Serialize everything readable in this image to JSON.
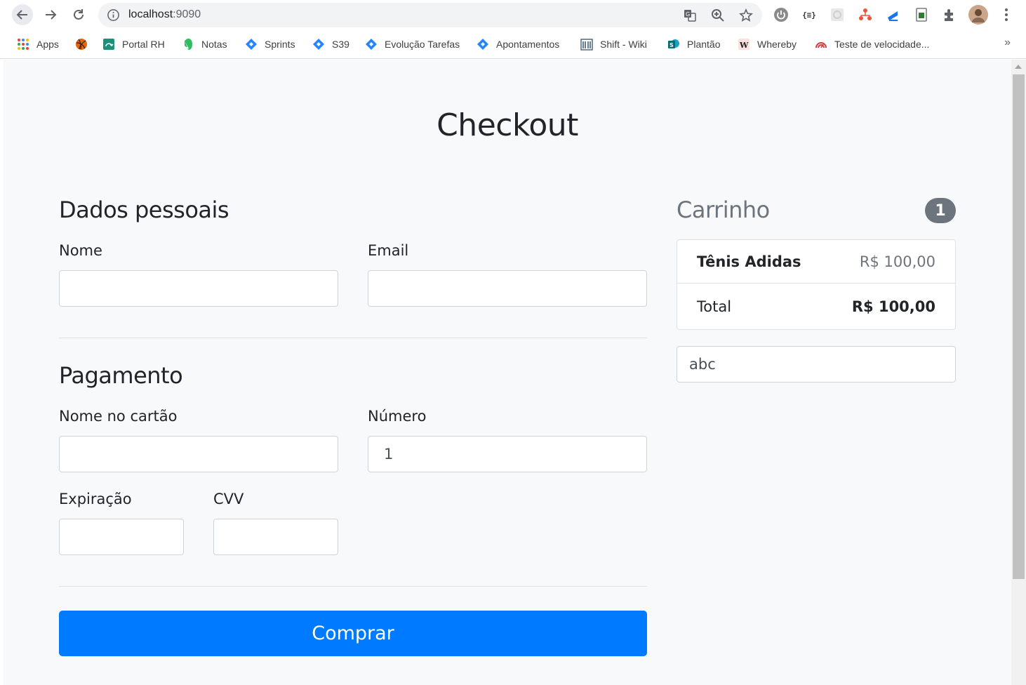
{
  "browser": {
    "url_host": "localhost",
    "url_port": ":9090",
    "bookmarks": [
      "Apps",
      "",
      "Portal RH",
      "Notas",
      "Sprints",
      "S39",
      "Evolução Tarefas",
      "Apontamentos",
      "Shift - Wiki",
      "Plantão",
      "Whereby",
      "Teste de velocidade..."
    ],
    "more": "»"
  },
  "page": {
    "title": "Checkout"
  },
  "personal": {
    "heading": "Dados pessoais",
    "name_label": "Nome",
    "name_value": "",
    "email_label": "Email",
    "email_value": ""
  },
  "payment": {
    "heading": "Pagamento",
    "card_name_label": "Nome no cartão",
    "card_name_value": "",
    "number_label": "Número",
    "number_value": "1",
    "expiration_label": "Expiração",
    "expiration_value": "",
    "cvv_label": "CVV",
    "cvv_value": ""
  },
  "submit_label": "Comprar",
  "cart": {
    "title": "Carrinho",
    "count": "1",
    "item_name": "Tênis Adidas",
    "item_price": "R$ 100,00",
    "total_label": "Total",
    "total_value": "R$ 100,00",
    "promo_value": "abc"
  },
  "colors": {
    "primary": "#007bff",
    "badge": "#6c757d",
    "page_bg": "#f8f9fa"
  }
}
